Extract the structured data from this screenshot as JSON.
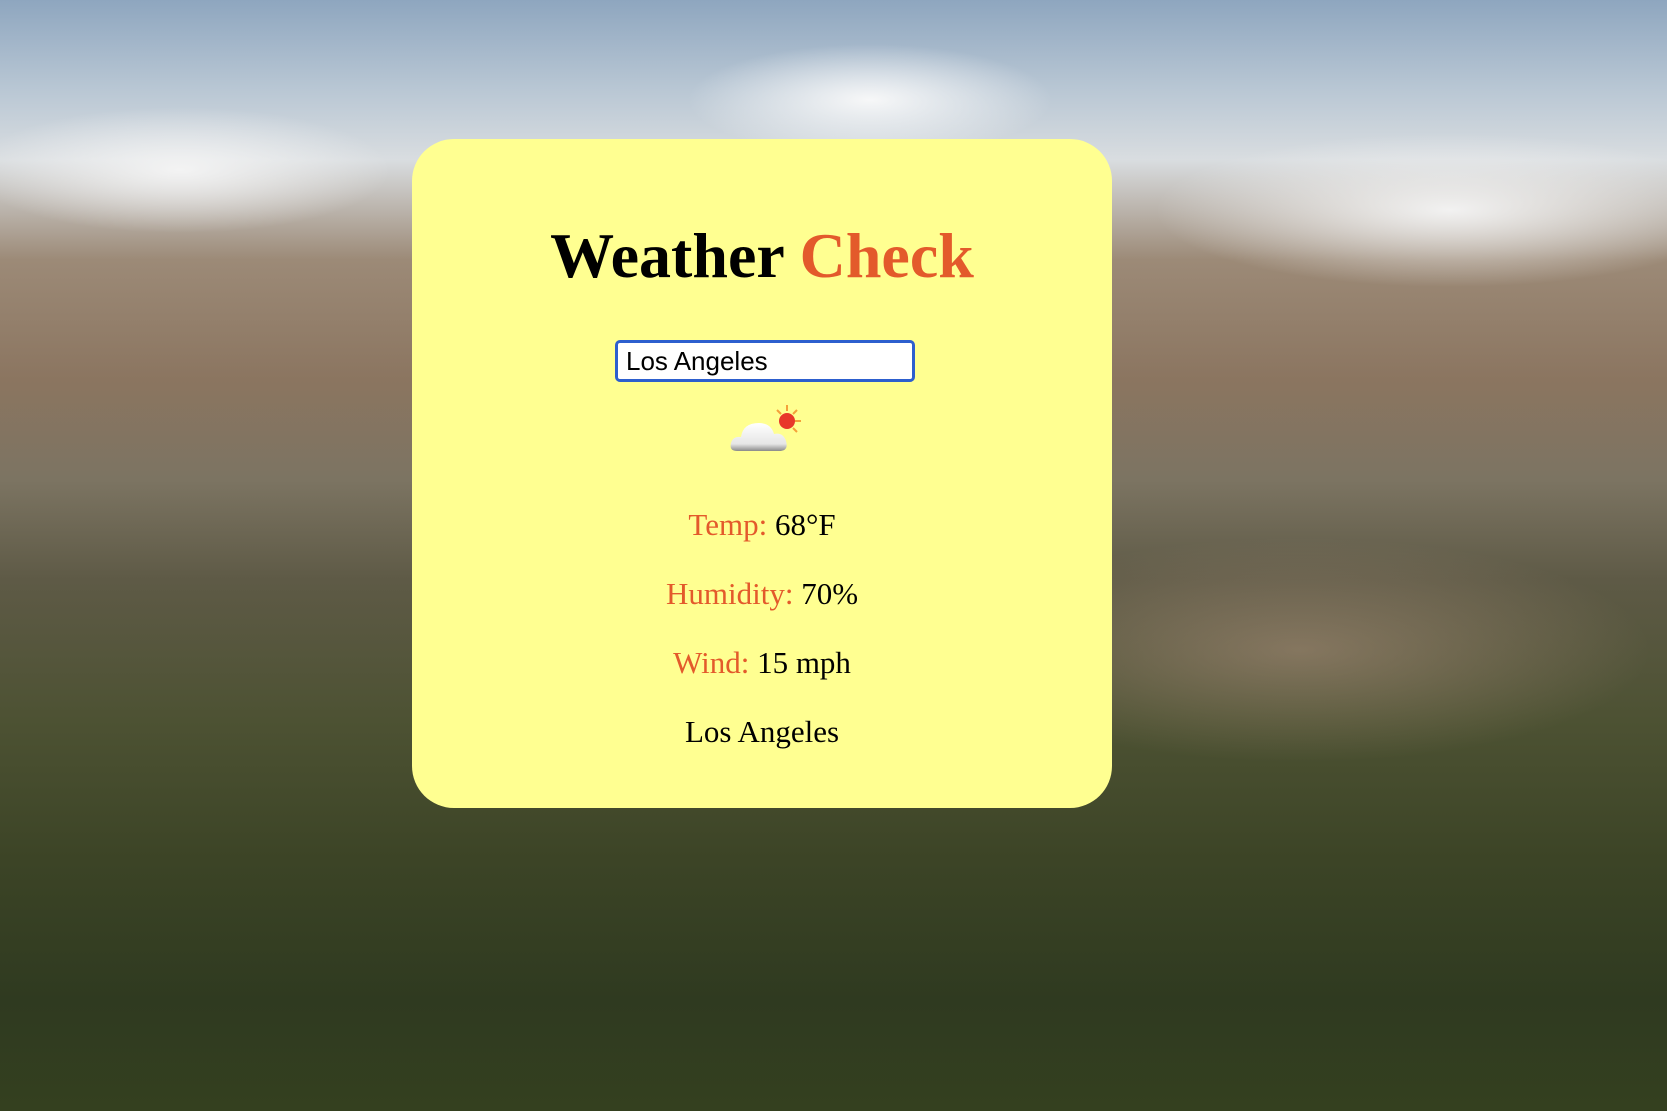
{
  "title": {
    "word1": "Weather",
    "word2": "Check"
  },
  "search": {
    "value": "Los Angeles"
  },
  "weather_icon": "cloud-sun-icon",
  "stats": [
    {
      "label": "Temp:",
      "value": "68°F"
    },
    {
      "label": "Humidity:",
      "value": "70%"
    },
    {
      "label": "Wind:",
      "value": "15 mph"
    }
  ],
  "city": "Los Angeles",
  "colors": {
    "card": "#ffff91",
    "accent": "#e35a2b",
    "focus": "#2d5fce"
  }
}
